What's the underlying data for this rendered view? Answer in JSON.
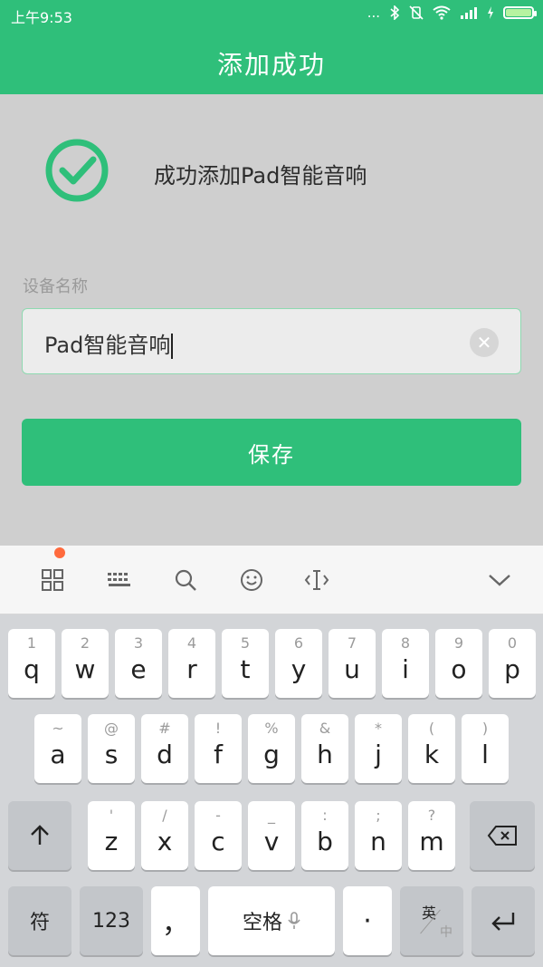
{
  "status_bar": {
    "time": "上午9:53",
    "dots": "..."
  },
  "title_bar": {
    "title": "添加成功"
  },
  "result": {
    "message": "成功添加Pad智能音响"
  },
  "device_name": {
    "label": "设备名称",
    "value": "Pad智能音响",
    "clear_symbol": "✕"
  },
  "save_button": {
    "label": "保存"
  },
  "keyboard": {
    "row1": [
      {
        "main": "q",
        "sub": "1"
      },
      {
        "main": "w",
        "sub": "2"
      },
      {
        "main": "e",
        "sub": "3"
      },
      {
        "main": "r",
        "sub": "4"
      },
      {
        "main": "t",
        "sub": "5"
      },
      {
        "main": "y",
        "sub": "6"
      },
      {
        "main": "u",
        "sub": "7"
      },
      {
        "main": "i",
        "sub": "8"
      },
      {
        "main": "o",
        "sub": "9"
      },
      {
        "main": "p",
        "sub": "0"
      }
    ],
    "row2": [
      {
        "main": "a",
        "sub": "~"
      },
      {
        "main": "s",
        "sub": "@"
      },
      {
        "main": "d",
        "sub": "#"
      },
      {
        "main": "f",
        "sub": "!"
      },
      {
        "main": "g",
        "sub": "%"
      },
      {
        "main": "h",
        "sub": "&"
      },
      {
        "main": "j",
        "sub": "*"
      },
      {
        "main": "k",
        "sub": "("
      },
      {
        "main": "l",
        "sub": ")"
      }
    ],
    "row3": [
      {
        "main": "z",
        "sub": "'"
      },
      {
        "main": "x",
        "sub": "/"
      },
      {
        "main": "c",
        "sub": "-"
      },
      {
        "main": "v",
        "sub": "_"
      },
      {
        "main": "b",
        "sub": ":"
      },
      {
        "main": "n",
        "sub": ";"
      },
      {
        "main": "m",
        "sub": "?"
      }
    ],
    "symbols_label": "符",
    "numbers_label": "123",
    "comma_label": "，",
    "space_label": "空格",
    "period_label": "·",
    "lang_en": "英",
    "lang_zh": "中"
  }
}
